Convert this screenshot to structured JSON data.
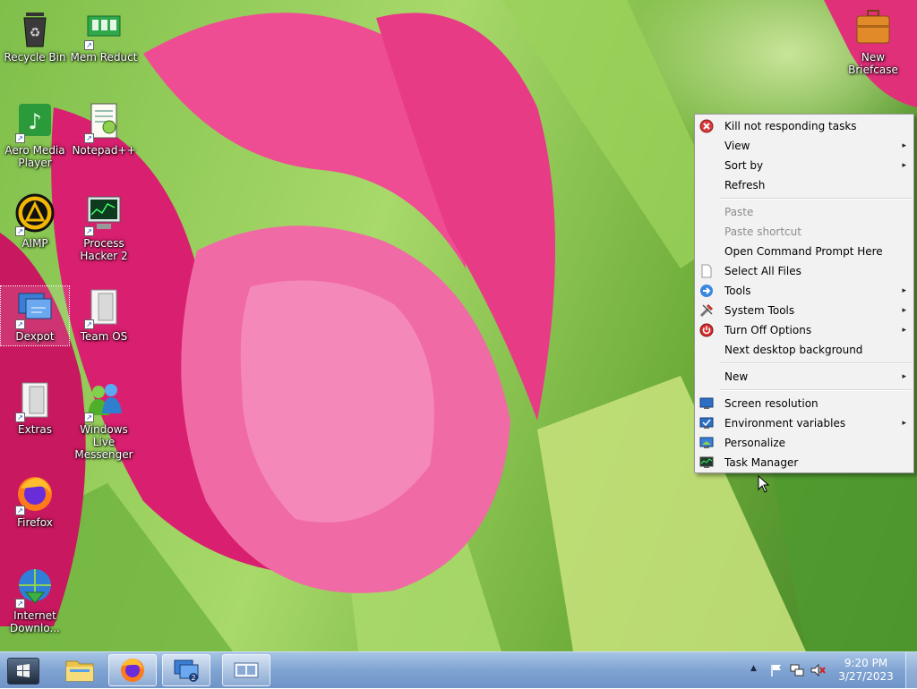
{
  "desktop": {
    "icons": [
      {
        "label": "Recycle Bin"
      },
      {
        "label": "Mem Reduct"
      },
      {
        "label": "New Briefcase"
      },
      {
        "label": "Aero Media Player"
      },
      {
        "label": "Notepad++"
      },
      {
        "label": "AIMP"
      },
      {
        "label": "Process Hacker 2"
      },
      {
        "label": "Dexpot"
      },
      {
        "label": "Team OS"
      },
      {
        "label": "Extras"
      },
      {
        "label": "Windows Live Messenger"
      },
      {
        "label": "Firefox"
      },
      {
        "label": "Internet Downlo..."
      }
    ]
  },
  "context_menu": {
    "items": [
      {
        "label": "Kill not responding tasks",
        "icon": "close-circle-icon"
      },
      {
        "label": "View",
        "submenu": true
      },
      {
        "label": "Sort by",
        "submenu": true
      },
      {
        "label": "Refresh"
      },
      {
        "label": "Paste",
        "disabled": true
      },
      {
        "label": "Paste shortcut",
        "disabled": true
      },
      {
        "label": "Open Command Prompt Here"
      },
      {
        "label": "Select All Files",
        "icon": "page-icon"
      },
      {
        "label": "Tools",
        "submenu": true,
        "icon": "arrow-right-icon"
      },
      {
        "label": "System Tools",
        "submenu": true,
        "icon": "tools-icon"
      },
      {
        "label": "Turn Off Options",
        "submenu": true,
        "icon": "power-icon"
      },
      {
        "label": "Next desktop background"
      },
      {
        "label": "New",
        "submenu": true
      },
      {
        "label": "Screen resolution",
        "icon": "monitor-icon"
      },
      {
        "label": "Environment variables",
        "submenu": true,
        "icon": "monitor-check-icon"
      },
      {
        "label": "Personalize",
        "icon": "personalize-icon"
      },
      {
        "label": "Task Manager",
        "icon": "task-manager-icon"
      }
    ],
    "submenu_arrow": "▸"
  },
  "taskbar": {
    "start_icon": "windows-logo-icon",
    "pinned": [
      "file-explorer-icon",
      "firefox-icon",
      "dexpot-icon",
      "task-view-icon"
    ],
    "tray": {
      "overflow_arrow": "▲",
      "time": "9:20 PM",
      "date": "3/27/2023"
    }
  },
  "colors": {
    "menu_bg": "#f2f2f2",
    "taskbar": "#7fa3d2",
    "tulip": "#e0307a"
  }
}
